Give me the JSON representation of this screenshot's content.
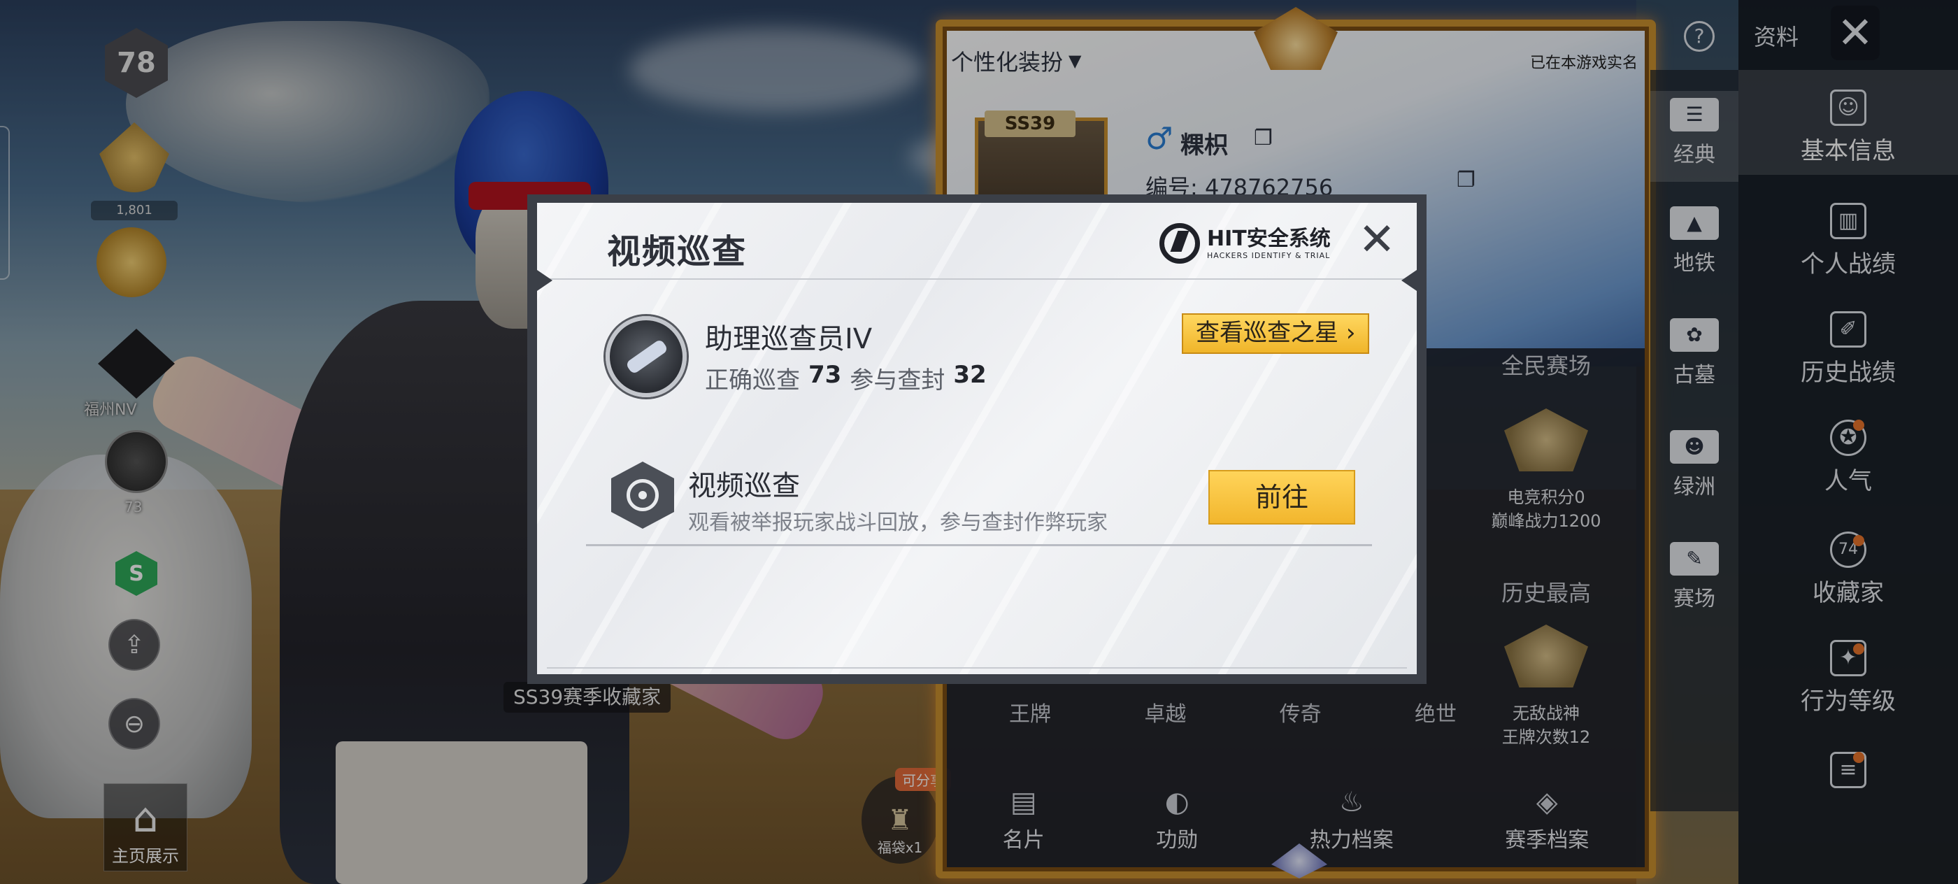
{
  "background": {
    "level": "78",
    "rank_badge_1_label": "1,801",
    "rank_badge_3_label": "福州NV",
    "rank_badge_4_label": "73",
    "green_badge_text": "S",
    "collector_tag": "SS39赛季收藏家",
    "home_label": "主页展示",
    "lucky_bag_label": "福袋x1",
    "share_tag": "可分享"
  },
  "profile": {
    "personal_title": "个性化装扮",
    "realname_status": "已在本游戏实名",
    "season_badge": "SS39",
    "nickname": "粿枳",
    "uid_line": "编号: 478762756",
    "national_title": "全民赛场",
    "national_stats": [
      "电竞积分0",
      "巅峰战力1200"
    ],
    "history_title": "历史最高",
    "history_stats": [
      "无敌战神",
      "王牌次数12"
    ],
    "tiers": [
      "王牌",
      "卓越",
      "传奇",
      "绝世"
    ],
    "tabs": [
      {
        "label": "名片",
        "icon": "card-icon"
      },
      {
        "label": "功勋",
        "icon": "medal-icon"
      },
      {
        "label": "热力档案",
        "icon": "fire-icon"
      },
      {
        "label": "赛季档案",
        "icon": "season-icon"
      }
    ]
  },
  "modes": [
    {
      "label": "经典",
      "icon": "classic-icon"
    },
    {
      "label": "地铁",
      "icon": "metro-icon"
    },
    {
      "label": "古墓",
      "icon": "tomb-icon"
    },
    {
      "label": "绿洲",
      "icon": "oasis-icon"
    },
    {
      "label": "赛场",
      "icon": "arena-icon"
    }
  ],
  "nav": {
    "help": "?",
    "data_label": "资料",
    "close": "✕",
    "items": [
      {
        "label": "基本信息",
        "icon": "user-icon"
      },
      {
        "label": "个人战绩",
        "icon": "chart-icon"
      },
      {
        "label": "历史战绩",
        "icon": "history-icon"
      },
      {
        "label": "人气",
        "icon": "popularity-icon"
      },
      {
        "label": "收藏家",
        "icon": "collector-icon",
        "badge": "74"
      },
      {
        "label": "行为等级",
        "icon": "behavior-icon"
      },
      {
        "label": "",
        "icon": "notes-icon"
      }
    ]
  },
  "modal": {
    "title": "视频巡查",
    "logo_main": "HIT安全系统",
    "logo_sub": "HACKERS IDENTIFY & TRIAL",
    "close": "✕",
    "rank_title": "助理巡查员IV",
    "correct_label": "正确巡查",
    "correct_value": "73",
    "join_label": "参与查封",
    "join_value": "32",
    "star_button": "查看巡查之星",
    "video_title": "视频巡查",
    "video_desc": "观看被举报玩家战斗回放，参与查封作弊玩家",
    "go_button": "前往"
  },
  "colors": {
    "accent_yellow": "#f2b62d",
    "frame_gold": "#c9902f",
    "notify_orange": "#e8742c"
  }
}
